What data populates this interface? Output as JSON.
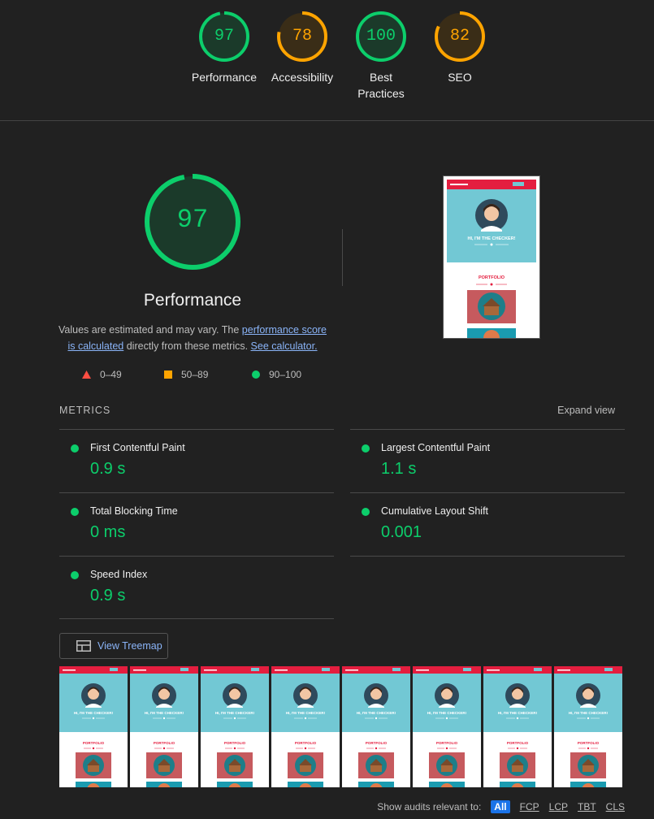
{
  "categories": [
    {
      "score": "97",
      "label": "Performance",
      "color": "#0cce6b",
      "fraction": 0.97
    },
    {
      "score": "78",
      "label": "Accessibility",
      "color": "#ffa400",
      "fraction": 0.78
    },
    {
      "score": "100",
      "label": "Best Practices",
      "color": "#0cce6b",
      "fraction": 1.0
    },
    {
      "score": "82",
      "label": "SEO",
      "color": "#ffa400",
      "fraction": 0.82
    }
  ],
  "performance": {
    "score": "97",
    "fraction": 0.97,
    "title": "Performance",
    "desc_prefix": "Values are estimated and may vary. The ",
    "link_score": "performance score is calculated",
    "desc_mid": " directly from these metrics. ",
    "link_calc": "See calculator."
  },
  "legend": {
    "fail": "0–49",
    "average": "50–89",
    "pass": "90–100"
  },
  "metrics": {
    "heading": "METRICS",
    "expand": "Expand view",
    "items": [
      {
        "name": "First Contentful Paint",
        "value": "0.9 s"
      },
      {
        "name": "Largest Contentful Paint",
        "value": "1.1 s"
      },
      {
        "name": "Total Blocking Time",
        "value": "0 ms"
      },
      {
        "name": "Cumulative Layout Shift",
        "value": "0.001"
      },
      {
        "name": "Speed Index",
        "value": "0.9 s"
      }
    ]
  },
  "treemap": {
    "label": "View Treemap"
  },
  "page_preview": {
    "hero_text": "HI, I'M THE CHECKER!",
    "section": "PORTFOLIO"
  },
  "footer": {
    "prefix": "Show audits relevant to:",
    "filters": [
      "All",
      "FCP",
      "LCP",
      "TBT",
      "CLS"
    ]
  },
  "colors": {
    "pass": "#0cce6b",
    "average": "#ffa400",
    "fail": "#ff4e42",
    "hero": "#72c8d4",
    "brand_red": "#e41e3f"
  }
}
